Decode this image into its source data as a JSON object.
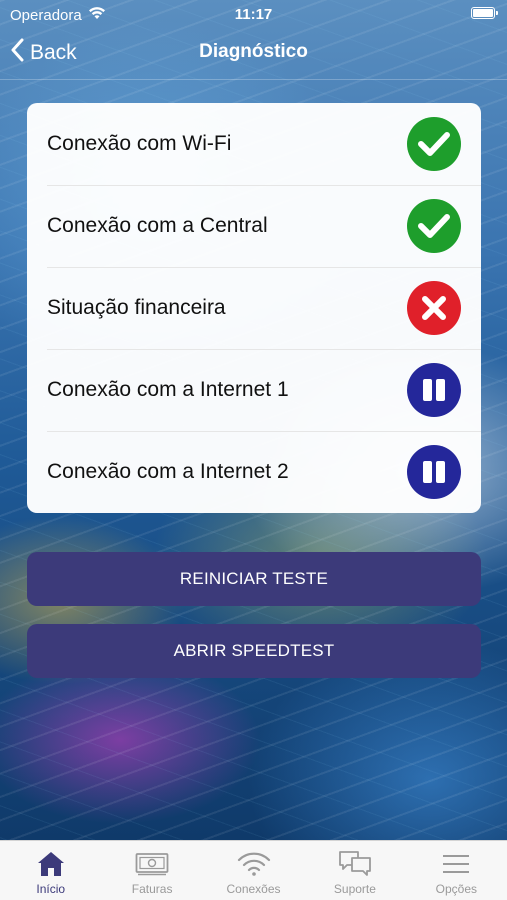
{
  "status_bar": {
    "carrier": "Operadora",
    "time": "11:17"
  },
  "nav": {
    "back_label": "Back",
    "title": "Diagnóstico"
  },
  "checks": [
    {
      "label": "Conexão com Wi-Fi",
      "status": "ok",
      "color": "#1e9e2c"
    },
    {
      "label": "Conexão com a Central",
      "status": "ok",
      "color": "#1e9e2c"
    },
    {
      "label": "Situação financeira",
      "status": "error",
      "color": "#e0202a"
    },
    {
      "label": "Conexão com a Internet 1",
      "status": "paused",
      "color": "#24279a"
    },
    {
      "label": "Conexão com a Internet 2",
      "status": "paused",
      "color": "#24279a"
    }
  ],
  "buttons": {
    "restart": "REINICIAR TESTE",
    "speedtest": "ABRIR SPEEDTEST"
  },
  "tabs": [
    {
      "label": "Início",
      "icon": "home-icon",
      "active": true
    },
    {
      "label": "Faturas",
      "icon": "bill-icon",
      "active": false
    },
    {
      "label": "Conexões",
      "icon": "wifi-icon",
      "active": false
    },
    {
      "label": "Suporte",
      "icon": "chat-icon",
      "active": false
    },
    {
      "label": "Opções",
      "icon": "menu-icon",
      "active": false
    }
  ],
  "colors": {
    "accent": "#3c3a7a",
    "ok": "#1e9e2c",
    "error": "#e0202a",
    "paused": "#24279a"
  }
}
